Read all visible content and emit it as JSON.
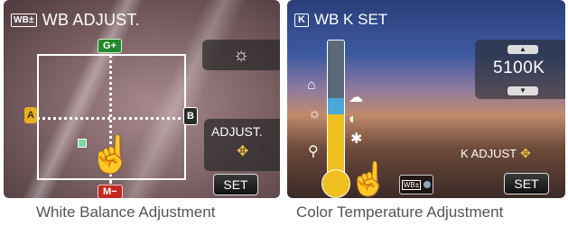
{
  "left_screen": {
    "mode_badge": "WB±",
    "title": "WB ADJUST.",
    "axes": {
      "green": "G+",
      "magenta": "M−",
      "amber": "A",
      "blue": "B"
    },
    "sun_icon": "sun-icon",
    "adjust_label": "ADJUST.",
    "adjust_icon": "touch-drag-icon",
    "set_label": "SET"
  },
  "right_screen": {
    "badge": "K",
    "title": "WB K SET",
    "kelvin_value": "5100K",
    "k_adjust_label": "K ADJUST",
    "set_label": "SET",
    "mode_chip": "WB±",
    "temperature_level": 0.45,
    "scale_icons": [
      "home-icon",
      "sun-icon",
      "bulb-icon"
    ],
    "scale_markers": [
      "cloud-icon",
      "shade-icon",
      "bulb-icon"
    ]
  },
  "captions": {
    "left": "White Balance Adjustment",
    "right": "Color Temperature Adjustment"
  },
  "colors": {
    "green_axis": "#1f8a2a",
    "magenta_axis": "#c5281f",
    "amber_axis": "#e8b020",
    "temp_warm": "#f0c020",
    "temp_cool": "#4aa8d8"
  }
}
